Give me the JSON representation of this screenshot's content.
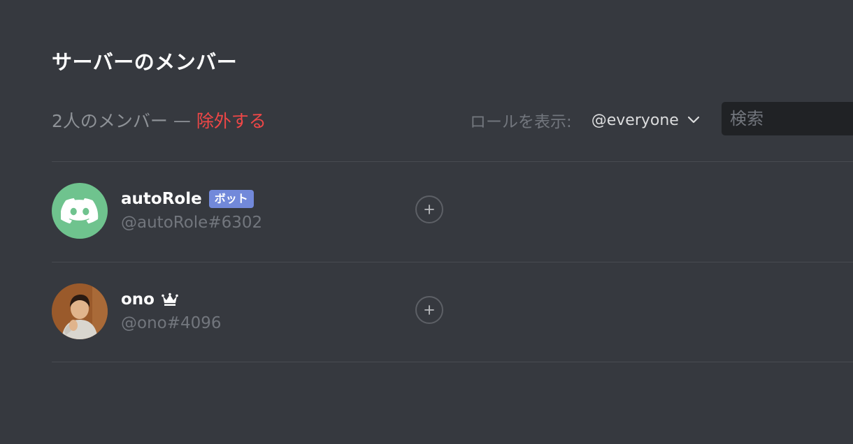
{
  "page": {
    "title": "サーバーのメンバー"
  },
  "header": {
    "member_count": "2人のメンバー",
    "separator": "—",
    "prune_label": "除外する",
    "role_filter_label": "ロールを表示:",
    "role_filter_value": "@everyone",
    "search_placeholder": "検索"
  },
  "members": [
    {
      "name": "autoRole",
      "badge": "ボット",
      "tag": "@autoRole#6302",
      "avatar": "discord-bot-avatar",
      "avatar_color": "#6fc38e"
    },
    {
      "name": "ono",
      "badge_icon": "crown-icon",
      "tag": "@ono#4096",
      "avatar": "user-photo-avatar"
    }
  ],
  "colors": {
    "background": "#36393f",
    "danger": "#f04747",
    "bot_badge": "#7289da",
    "muted_text": "#72767d"
  }
}
